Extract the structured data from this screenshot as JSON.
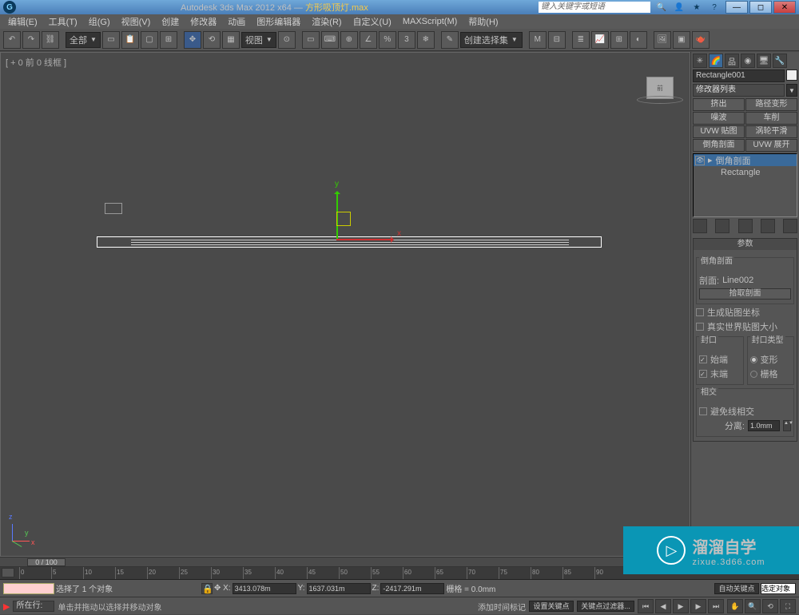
{
  "app": {
    "title": "Autodesk 3ds Max 2012 x64",
    "dash": "—",
    "document": "方形吸顶灯.max",
    "search_placeholder": "键入关键字或短语"
  },
  "menu": [
    "编辑(E)",
    "工具(T)",
    "组(G)",
    "视图(V)",
    "创建",
    "修改器",
    "动画",
    "图形编辑器",
    "渲染(R)",
    "自定义(U)",
    "MAXScript(M)",
    "帮助(H)"
  ],
  "toolbar": {
    "scope": "全部",
    "view": "视图",
    "selset": "创建选择集"
  },
  "viewport": {
    "label": "[ + 0 前 0 线框 ]",
    "ylabel": "y",
    "xlabel": "x"
  },
  "right": {
    "object_name": "Rectangle001",
    "modlist_label": "修改器列表",
    "buttons": [
      "挤出",
      "路径变形",
      "噪波",
      "车削",
      "UVW 贴图",
      "涡轮平滑",
      "倒角剖面",
      "UVW 展开"
    ],
    "stack": [
      "倒角剖面",
      "Rectangle"
    ],
    "params_hdr": "参数",
    "bevel_section": "倒角剖面",
    "section_label": "剖面:",
    "section_value": "Line002",
    "pick_section": "拾取剖面",
    "gen_uv": "生成贴图坐标",
    "realworld": "真实世界贴图大小",
    "cap_group": "封口",
    "cap_start": "始端",
    "cap_end": "末端",
    "captype_group": "封口类型",
    "captype_morph": "变形",
    "captype_grid": "栅格",
    "intersect_group": "相交",
    "avoid_intersect": "避免线相交",
    "separation": "分离:",
    "sep_value": "1.0mm"
  },
  "timeline": {
    "frame": "0 / 100",
    "ticks": [
      0,
      5,
      10,
      15,
      20,
      25,
      30,
      35,
      40,
      45,
      50,
      55,
      60,
      65,
      70,
      75,
      80,
      85,
      90
    ]
  },
  "status": {
    "selected": "选择了 1 个对象",
    "x": "3413.078m",
    "y": "1637.031m",
    "z": "-2417.291m",
    "grid": "栅格 = 0.0mm",
    "autokey": "自动关键点",
    "selpair": "选定对象",
    "location": "所在行:",
    "hint": "单击并拖动以选择并移动对象",
    "addtime": "添加时间标记",
    "setkey": "设置关键点",
    "keyfilter": "关键点过滤器..."
  },
  "watermark": {
    "big": "溜溜自学",
    "url": "zixue.3d66.com"
  }
}
